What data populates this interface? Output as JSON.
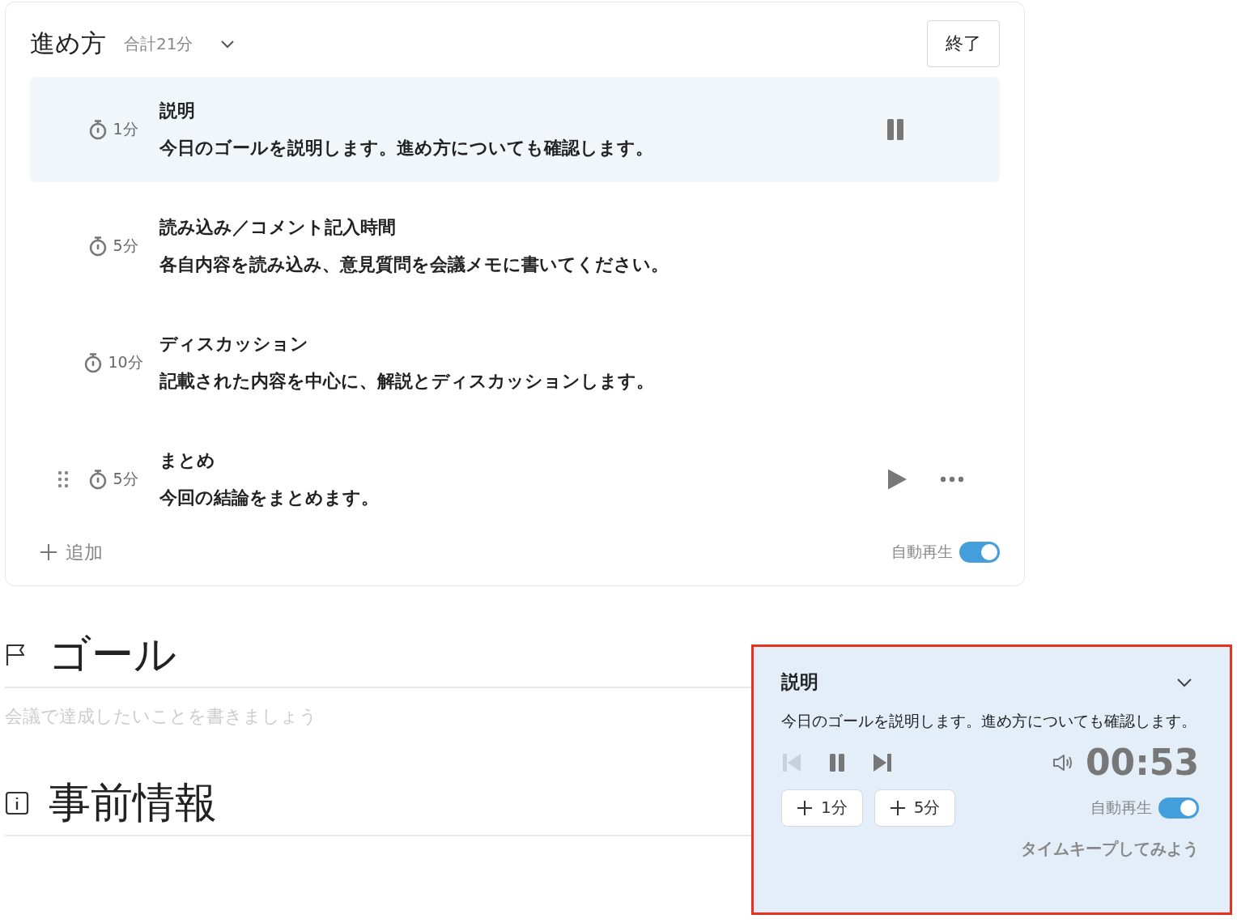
{
  "agenda": {
    "title": "進め方",
    "total": "合計21分",
    "end_button": "終了",
    "steps": [
      {
        "duration": "1分",
        "title": "説明",
        "description": "今日のゴールを説明します。進め方についても確認します。",
        "selected": true,
        "hovered": false
      },
      {
        "duration": "5分",
        "title": "読み込み／コメント記入時間",
        "description": "各自内容を読み込み、意見質問を会議メモに書いてください。",
        "selected": false,
        "hovered": false
      },
      {
        "duration": "10分",
        "title": "ディスカッション",
        "description": "記載された内容を中心に、解説とディスカッションします。",
        "selected": false,
        "hovered": false
      },
      {
        "duration": "5分",
        "title": "まとめ",
        "description": "今回の結論をまとめます。",
        "selected": false,
        "hovered": true
      }
    ],
    "add_label": "追加",
    "autoplay": {
      "label": "自動再生",
      "on": true
    }
  },
  "sections": [
    {
      "kind": "goal",
      "title": "ゴール",
      "placeholder": "会議で達成したいことを書きましょう"
    },
    {
      "kind": "info",
      "title": "事前情報"
    }
  ],
  "timer": {
    "step_title": "説明",
    "description": "今日のゴールを説明します。進め方についても確認します。",
    "time": "00:53",
    "playing": true,
    "previous_disabled": true,
    "add_buttons": [
      "1分",
      "5分"
    ],
    "autoplay": {
      "label": "自動再生",
      "on": true
    },
    "hint": "タイムキープしてみよう"
  }
}
